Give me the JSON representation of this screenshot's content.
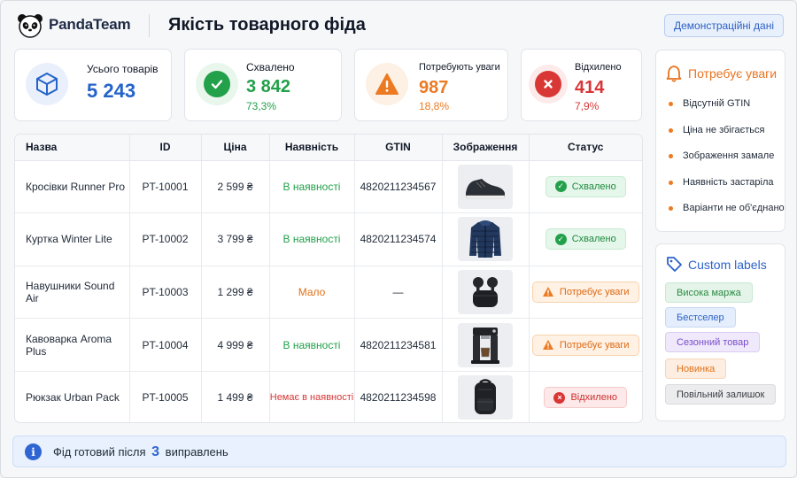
{
  "header": {
    "brand": "PandaTeam",
    "title": "Якість товарного фіда",
    "demo_button": "Демонстраційні дані"
  },
  "stats": [
    {
      "label": "Усього товарів",
      "value": "5 243",
      "percent": "",
      "color": "#2563c9",
      "icon": "cube-icon"
    },
    {
      "label": "Схвалено",
      "value": "3 842",
      "percent": "73,3%",
      "color": "#22a04a",
      "icon": "check-icon"
    },
    {
      "label": "Потребують уваги",
      "value": "987",
      "percent": "18,8%",
      "color": "#ec7a22",
      "icon": "warning-icon"
    },
    {
      "label": "Відхилено",
      "value": "414",
      "percent": "7,9%",
      "color": "#d93636",
      "icon": "close-icon"
    }
  ],
  "table": {
    "columns": [
      "Назва",
      "ID",
      "Ціна",
      "Наявність",
      "GTIN",
      "Зображення",
      "Статус"
    ],
    "rows": [
      {
        "name": "Кросівки Runner Pro",
        "id": "PT-10001",
        "price": "2 599 ₴",
        "availability": "В наявності",
        "gtin": "4820211234567",
        "image": "sneaker-image",
        "status": "Схвалено"
      },
      {
        "name": "Куртка Winter Lite",
        "id": "PT-10002",
        "price": "3 799 ₴",
        "availability": "В наявності",
        "gtin": "4820211234574",
        "image": "jacket-image",
        "status": "Схвалено"
      },
      {
        "name": "Навушники Sound Air",
        "id": "PT-10003",
        "price": "1 299 ₴",
        "availability": "Мало",
        "gtin": "—",
        "image": "earbuds-image",
        "status": "Потребує уваги"
      },
      {
        "name": "Кавоварка Aroma Plus",
        "id": "PT-10004",
        "price": "4 999 ₴",
        "availability": "В наявності",
        "gtin": "4820211234581",
        "image": "coffee-machine-image",
        "status": "Потребує уваги"
      },
      {
        "name": "Рюкзак Urban Pack",
        "id": "PT-10005",
        "price": "1 499 ₴",
        "availability": "Немає в наявності",
        "gtin": "4820211234598",
        "image": "backpack-image",
        "status": "Відхилено"
      }
    ]
  },
  "attention": {
    "title": "Потребує уваги",
    "items": [
      "Відсутній GTIN",
      "Ціна не збігається",
      "Зображення замале",
      "Наявність застаріла",
      "Варіанти не об'єднано"
    ]
  },
  "custom_labels": {
    "title": "Custom labels",
    "tags": [
      "Висока маржа",
      "Бестселер",
      "Сезонний товар",
      "Новинка",
      "Повільний залишок"
    ]
  },
  "footer": {
    "prefix": "Фід готовий після",
    "count": "3",
    "suffix": "виправлень"
  }
}
